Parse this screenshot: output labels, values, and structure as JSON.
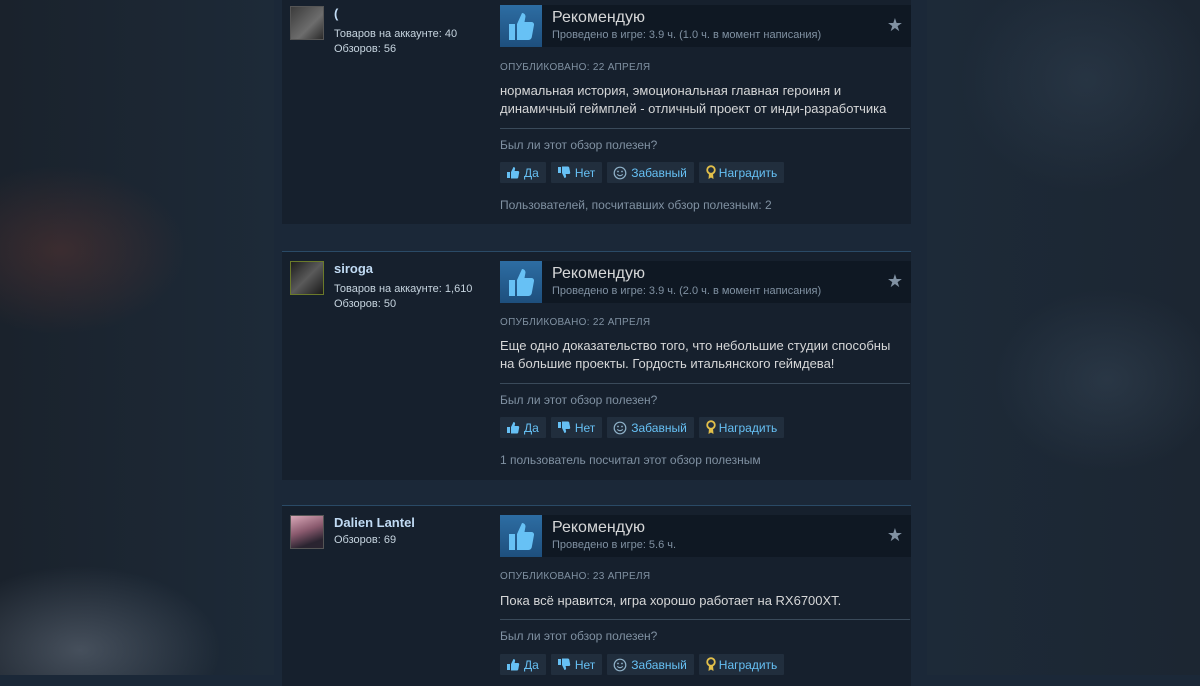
{
  "labels": {
    "helpful_question": "Был ли этот обзор полезен?",
    "btn_yes": "Да",
    "btn_no": "Нет",
    "btn_funny": "Забавный",
    "btn_award": "Наградить"
  },
  "reviews": [
    {
      "author": "(",
      "products": "Товаров на аккаунте: 40",
      "reviews_count": "Обзоров: 56",
      "verdict": "Рекомендую",
      "hours": "Проведено в игре: 3.9 ч. (1.0 ч. в момент написания)",
      "posted": "ОПУБЛИКОВАНО: 22 АПРЕЛЯ",
      "text": "нормальная история, эмоциональная главная героиня и динамичный геймплей - отличный проект от инди-разработчика",
      "helpful_count": "Пользователей, посчитавших обзор полезным: 2"
    },
    {
      "author": "siroga",
      "products": "Товаров на аккаунте: 1,610",
      "reviews_count": "Обзоров: 50",
      "verdict": "Рекомендую",
      "hours": "Проведено в игре: 3.9 ч. (2.0 ч. в момент написания)",
      "posted": "ОПУБЛИКОВАНО: 22 АПРЕЛЯ",
      "text": "Еще одно доказательство того, что небольшие студии способны на большие проекты. Гордость итальянского геймдева!",
      "helpful_count": "1 пользователь посчитал этот обзор полезным"
    },
    {
      "author": "Dalien Lantel",
      "reviews_count": "Обзоров: 69",
      "verdict": "Рекомендую",
      "hours": "Проведено в игре: 5.6 ч.",
      "posted": "ОПУБЛИКОВАНО: 23 АПРЕЛЯ",
      "text": "Пока всё нравится, игра хорошо работает на RX6700XT."
    }
  ],
  "icons": {
    "recommend": "thumbs-up-icon",
    "star": "star-icon",
    "yes": "thumbs-up-icon",
    "no": "thumbs-down-icon",
    "funny": "smiley-icon",
    "award": "award-icon"
  },
  "colors": {
    "background": "#1b2838",
    "review_bg": "#16202d",
    "link_blue": "#66c0f4",
    "thumb_blue": "#2d6da3",
    "award_gold": "#e3c04a"
  }
}
